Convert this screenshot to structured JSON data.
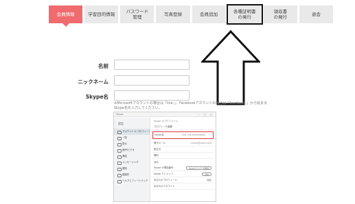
{
  "tabs": [
    {
      "label": "会員情報",
      "active": true
    },
    {
      "label": "学習目的情報"
    },
    {
      "label": "パスワード\n管理"
    },
    {
      "label": "写真登録"
    },
    {
      "label": "会員追加"
    },
    {
      "label": "各種証明書\nの発行",
      "highlight": true
    },
    {
      "label": "領収書\nの発行"
    },
    {
      "label": "退会"
    }
  ],
  "form": {
    "name_label": "名前",
    "nickname_label": "ニックネーム",
    "skype_label": "Skype名",
    "note": "※Microsoftアカウントの場合は「live:」、Facebookアカウントの場合は「facebook:」から始まるSkype名を入力してください。"
  },
  "skype": {
    "window_title": "Skype",
    "sidebar_heading": "設定",
    "sidebar_items": [
      "アカウント & プロフィール",
      "一般",
      "表示",
      "音声/ビデオ",
      "通話",
      "メッセージング",
      "通知",
      "連絡先",
      "ヘルプとフィードバック"
    ],
    "section_header": "Skype のプロファイル",
    "profile_link": "プロフィール編集",
    "skype_name_label": "Skype名",
    "skype_name_value": "live: cid.xxfacebook",
    "email_label": "電子メール",
    "email_value": "xxxxx@xxxx.com",
    "birthday_label": "誕生日",
    "location_label": "場所",
    "phone_section": "通話",
    "phone_label": "Skype の電話番号",
    "phone_button": "Skype ナンバーを取得",
    "credit_label": "Skype クレジット",
    "credit_button": "追加",
    "other_rows": [
      "あなたのプロフィール",
      "あなたのアカウント"
    ],
    "accent_red": "#e0343a"
  },
  "colors": {
    "tab_active": "#f06b6e",
    "tab_bg": "#e9e9e9"
  }
}
